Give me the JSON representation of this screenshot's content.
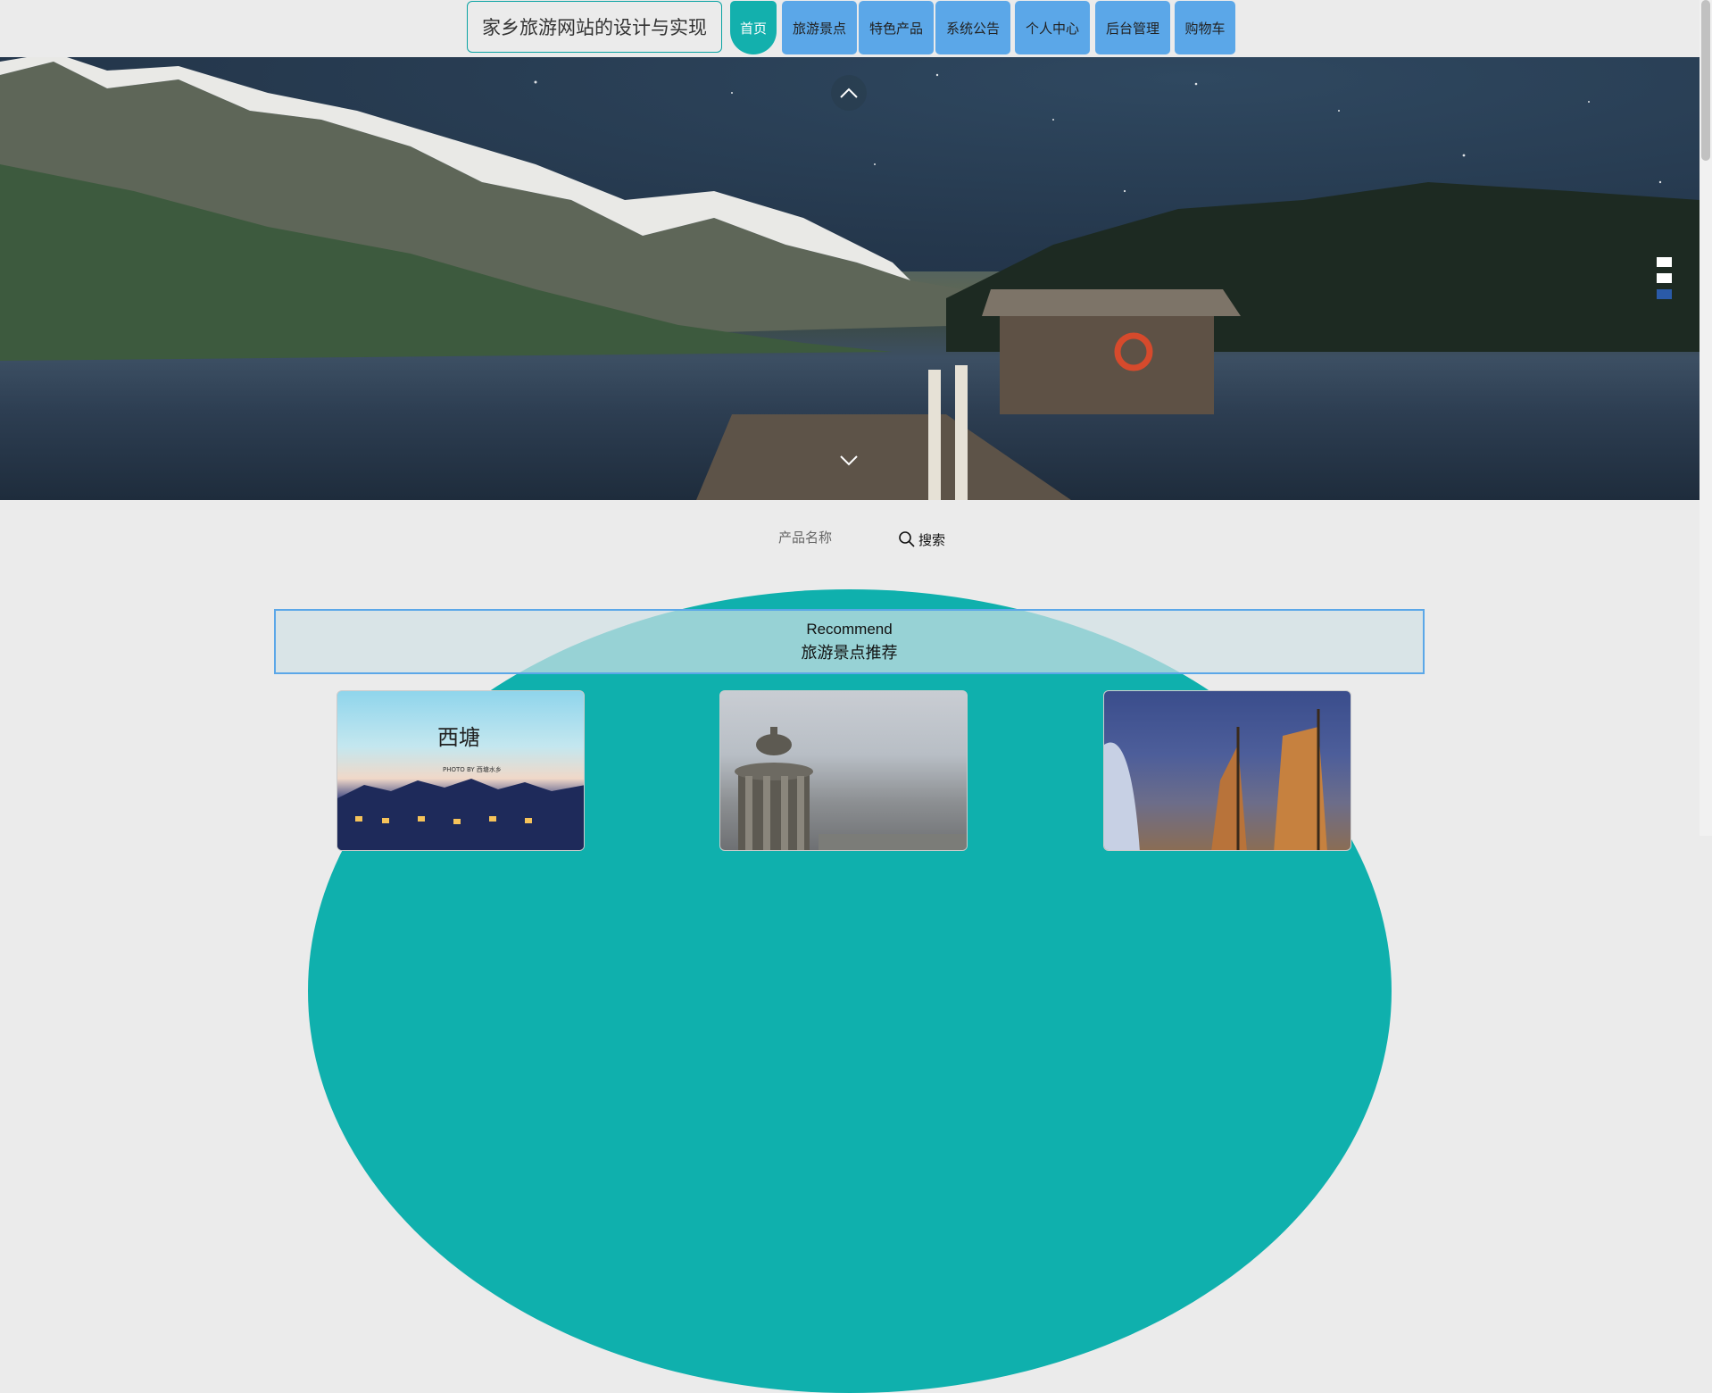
{
  "site_title": "家乡旅游网站的设计与实现",
  "nav": [
    {
      "label": "首页",
      "active": true
    },
    {
      "label": "旅游景点",
      "active": false
    },
    {
      "label": "特色产品",
      "active": false
    },
    {
      "label": "系统公告",
      "active": false
    },
    {
      "label": "个人中心",
      "active": false
    },
    {
      "label": "后台管理",
      "active": false
    },
    {
      "label": "购物车",
      "active": false
    }
  ],
  "carousel": {
    "slide_count": 3,
    "active_index": 2
  },
  "search": {
    "placeholder": "产品名称",
    "button_label": "搜索"
  },
  "recommend": {
    "title_en": "Recommend",
    "title_cn": "旅游景点推荐",
    "cards": [
      {
        "image_text": "西塘",
        "image_subtext": "PHOTO BY 西塘水乡"
      },
      {
        "image_text": ""
      },
      {
        "image_text": ""
      }
    ]
  },
  "colors": {
    "nav_button": "#5ba7e8",
    "nav_active": "#13b0ad",
    "accent_teal": "#0fb0ad",
    "dot_active": "#2a5aa8"
  }
}
